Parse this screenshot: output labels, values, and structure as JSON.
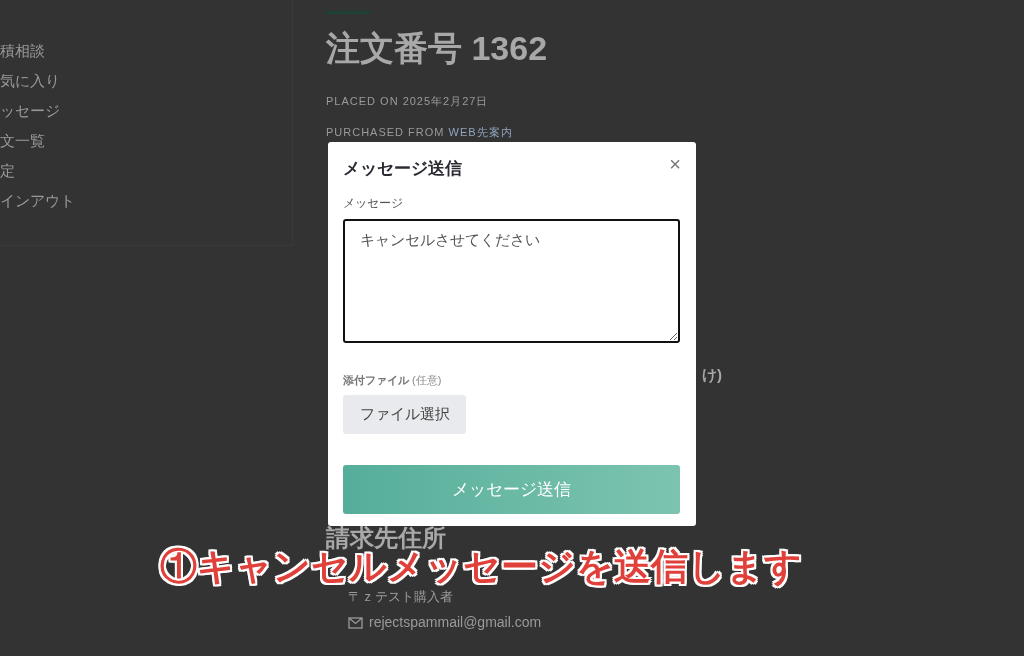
{
  "sidebar": {
    "items": [
      {
        "label": "積相談"
      },
      {
        "label": "気に入り"
      },
      {
        "label": "ッセージ"
      },
      {
        "label": "文一覧"
      },
      {
        "label": "定"
      },
      {
        "label": "インアウト"
      }
    ]
  },
  "order": {
    "title": "注文番号 1362",
    "placed_on": "PLACED ON 2025年2月27日",
    "purchased_from_label": "PURCHASED FROM",
    "purchased_from_link": "WEB先案内",
    "partial_text": "け)",
    "billing_heading": "請求先住所",
    "billing_name": "〒 z テスト購入者",
    "billing_email": "rejectspammail@gmail.com"
  },
  "dialog": {
    "title": "メッセージ送信",
    "close": "×",
    "message_label": "メッセージ",
    "message_value": "キャンセルさせてください",
    "attachment_label": "添付ファイル",
    "attachment_hint": "(任意)",
    "file_button": "ファイル選択",
    "submit_button": "メッセージ送信"
  },
  "annotation": {
    "text": "①キャンセルメッセージを送信します"
  }
}
